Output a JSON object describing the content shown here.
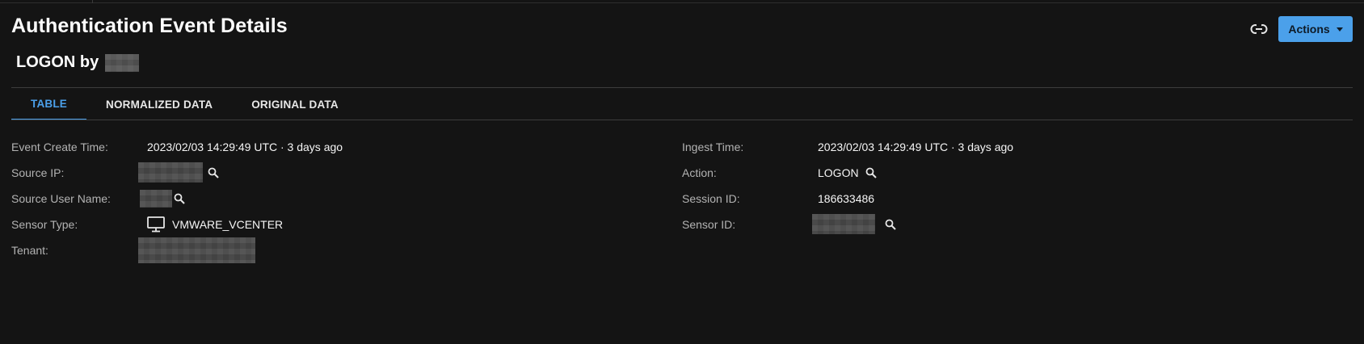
{
  "header": {
    "title": "Authentication Event Details",
    "subtitle_prefix": "LOGON by",
    "actions_label": "Actions"
  },
  "tabs": [
    {
      "label": "TABLE",
      "active": true
    },
    {
      "label": "NORMALIZED DATA",
      "active": false
    },
    {
      "label": "ORIGINAL DATA",
      "active": false
    }
  ],
  "left_fields": {
    "event_create_time": {
      "label": "Event Create Time:",
      "value": "2023/02/03 14:29:49 UTC · 3 days ago"
    },
    "source_ip": {
      "label": "Source IP:"
    },
    "source_user_name": {
      "label": "Source User Name:"
    },
    "sensor_type": {
      "label": "Sensor Type:",
      "value": "VMWARE_VCENTER",
      "icon": "monitor-icon"
    },
    "tenant": {
      "label": "Tenant:"
    }
  },
  "right_fields": {
    "ingest_time": {
      "label": "Ingest Time:",
      "value": "2023/02/03 14:29:49 UTC · 3 days ago"
    },
    "action": {
      "label": "Action:",
      "value": "LOGON"
    },
    "session_id": {
      "label": "Session ID:",
      "value": "186633486"
    },
    "sensor_id": {
      "label": "Sensor ID:"
    }
  },
  "colors": {
    "background": "#141414",
    "accent": "#4ba0ea",
    "label": "#b3b3b3",
    "value": "#f5f5f5"
  }
}
